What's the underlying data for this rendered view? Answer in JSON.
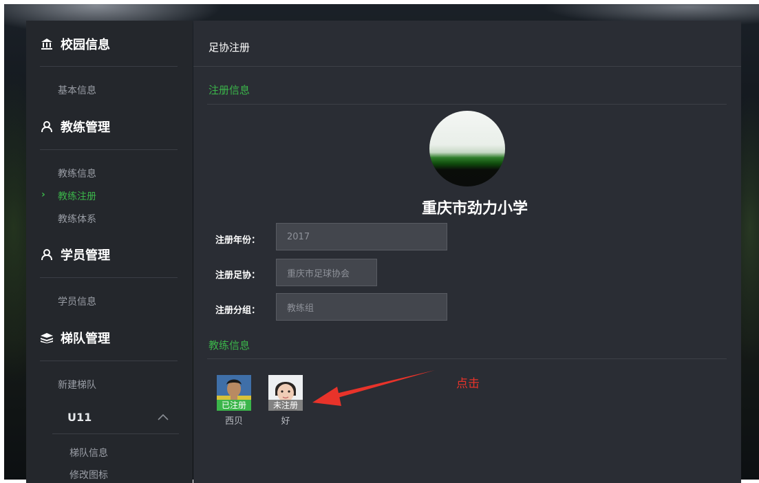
{
  "sidebar": {
    "sections": [
      {
        "icon": "campus-icon",
        "title": "校园信息",
        "items": [
          {
            "label": "基本信息"
          }
        ]
      },
      {
        "icon": "user-icon",
        "title": "教练管理",
        "items": [
          {
            "label": "教练信息"
          },
          {
            "label": "教练注册",
            "active": true
          },
          {
            "label": "教练体系"
          }
        ]
      },
      {
        "icon": "user-icon",
        "title": "学员管理",
        "items": [
          {
            "label": "学员信息"
          }
        ]
      },
      {
        "icon": "stack-icon",
        "title": "梯队管理",
        "items": [
          {
            "label": "新建梯队"
          }
        ]
      }
    ],
    "team": {
      "name": "U11",
      "items": [
        {
          "label": "梯队信息"
        },
        {
          "label": "修改图标"
        }
      ]
    }
  },
  "main": {
    "title": "足协注册",
    "registration_section": "注册信息",
    "school_name": "重庆市劲力小学",
    "form": {
      "year_label": "注册年份：",
      "year_value": "2017",
      "association_label": "注册足协：",
      "association_value": "重庆市足球协会",
      "group_label": "注册分组：",
      "group_value": "教练组"
    },
    "coach_section": "教练信息",
    "coaches": [
      {
        "name": "西贝",
        "status": "已注册"
      },
      {
        "name": "好",
        "status": "未注册"
      }
    ],
    "annotation": "点击"
  },
  "colors": {
    "accent_green": "#3bb54a",
    "annotation_red": "#e8332a",
    "panel_bg": "#2a2d34",
    "sidebar_bg": "#24272c"
  }
}
